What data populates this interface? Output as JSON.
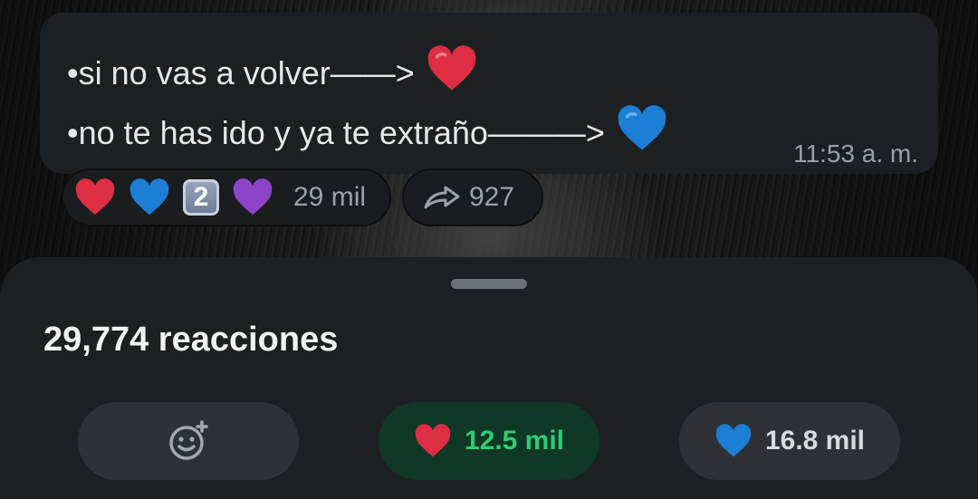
{
  "message": {
    "line1": "•si no vas a volver——>",
    "line2": "•no te has ido y ya te extraño———>",
    "time": "11:53 a. m."
  },
  "reactions_bar": {
    "badge_number": "2",
    "count": "29 mil"
  },
  "forward": {
    "count": "927"
  },
  "sheet": {
    "title": "29,774 reacciones",
    "chips": {
      "red_heart_count": "12.5 mil",
      "blue_heart_count": "16.8 mil"
    }
  },
  "colors": {
    "accent_green": "#2fcb74",
    "selected_chip_bg": "#103826",
    "bubble_bg": "#1d2023"
  },
  "icons": {
    "red_heart": "red-heart-icon",
    "blue_heart": "blue-heart-icon",
    "purple_heart": "purple-heart-icon",
    "forward": "forward-icon",
    "add_reaction": "add-reaction-icon"
  }
}
